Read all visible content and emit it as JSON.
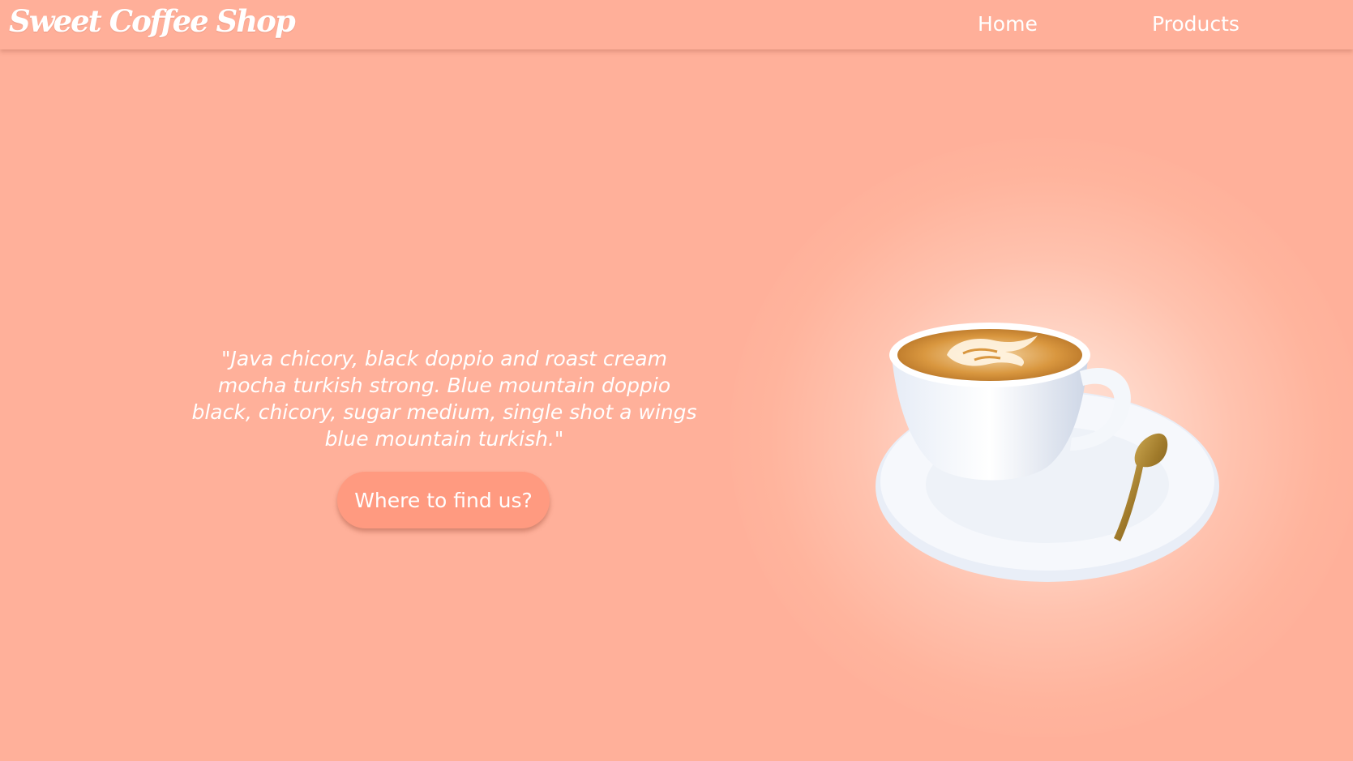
{
  "header": {
    "logo_text": "Sweet Coffee Shop",
    "nav": [
      {
        "label": "Home"
      },
      {
        "label": "Products"
      }
    ]
  },
  "hero": {
    "quote": "\"Java chicory, black doppio and roast cream mocha turkish strong. Blue mountain doppio black, chicory, sugar medium, single shot a wings blue mountain turkish.\"",
    "button_label": "Where to find us?",
    "image_icon": "coffee-cup-icon"
  },
  "colors": {
    "background": "#ffb09a",
    "button": "#ff9a80",
    "text": "#ffffff"
  }
}
